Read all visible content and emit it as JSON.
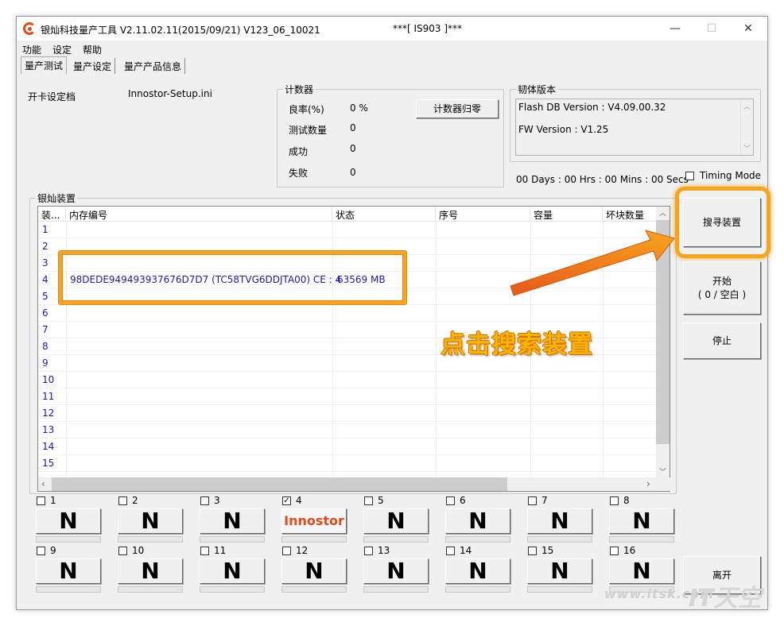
{
  "window": {
    "title": "银灿科技量产工具 V2.11.02.11(2015/09/21)    V123_06_10021",
    "title_center": "***[ IS903 ]***",
    "minimize": "—",
    "maximize": "☐",
    "close": "✕"
  },
  "menu": {
    "items": [
      "功能",
      "设定",
      "帮助"
    ]
  },
  "tabs": [
    "量产测试",
    "量产设定",
    "量产产品信息"
  ],
  "config": {
    "label": "开卡设定档",
    "value": "Innostor-Setup.ini"
  },
  "counter": {
    "legend": "计数器",
    "rows": [
      {
        "label": "良率(%)",
        "value": "0 %"
      },
      {
        "label": "测试数量",
        "value": "0"
      },
      {
        "label": "成功",
        "value": "0"
      },
      {
        "label": "失败",
        "value": "0"
      }
    ],
    "reset_button": "计数器归零"
  },
  "firmware": {
    "legend": "韧体版本",
    "flash_db": "Flash DB Version :  V4.09.00.32",
    "fw": "FW Version :   V1.25"
  },
  "timer": "00 Days : 00 Hrs : 00 Mins : 00 Secs",
  "timing_mode": "Timing Mode",
  "devices": {
    "legend": "银灿装置",
    "columns": [
      "装...",
      "内存编号",
      "状态",
      "序号",
      "容量",
      "坏块数量"
    ],
    "rows": [
      {
        "n": "1",
        "memory": "",
        "status": ""
      },
      {
        "n": "2",
        "memory": "",
        "status": ""
      },
      {
        "n": "3",
        "memory": "",
        "status": ""
      },
      {
        "n": "4",
        "memory": "98DEDE949493937676D7D7 (TC58TVG6DDJTA00) CE : 4",
        "status": "63569 MB"
      },
      {
        "n": "5",
        "memory": "",
        "status": ""
      },
      {
        "n": "6",
        "memory": "",
        "status": ""
      },
      {
        "n": "7",
        "memory": "",
        "status": ""
      },
      {
        "n": "8",
        "memory": "",
        "status": ""
      },
      {
        "n": "9",
        "memory": "",
        "status": ""
      },
      {
        "n": "10",
        "memory": "",
        "status": ""
      },
      {
        "n": "11",
        "memory": "",
        "status": ""
      },
      {
        "n": "12",
        "memory": "",
        "status": ""
      },
      {
        "n": "13",
        "memory": "",
        "status": ""
      },
      {
        "n": "14",
        "memory": "",
        "status": ""
      },
      {
        "n": "15",
        "memory": "",
        "status": ""
      }
    ]
  },
  "side_buttons": {
    "search": "搜寻装置",
    "start_line1": "开始",
    "start_line2": "( 0 / 空白 )",
    "stop": "停止",
    "exit": "离开"
  },
  "slots": [
    {
      "n": "1",
      "checked": false,
      "label": "N"
    },
    {
      "n": "2",
      "checked": false,
      "label": "N"
    },
    {
      "n": "3",
      "checked": false,
      "label": "N"
    },
    {
      "n": "4",
      "checked": true,
      "label": "Innostor"
    },
    {
      "n": "5",
      "checked": false,
      "label": "N"
    },
    {
      "n": "6",
      "checked": false,
      "label": "N"
    },
    {
      "n": "7",
      "checked": false,
      "label": "N"
    },
    {
      "n": "8",
      "checked": false,
      "label": "N"
    },
    {
      "n": "9",
      "checked": false,
      "label": "N"
    },
    {
      "n": "10",
      "checked": false,
      "label": "N"
    },
    {
      "n": "11",
      "checked": false,
      "label": "N"
    },
    {
      "n": "12",
      "checked": false,
      "label": "N"
    },
    {
      "n": "13",
      "checked": false,
      "label": "N"
    },
    {
      "n": "14",
      "checked": false,
      "label": "N"
    },
    {
      "n": "15",
      "checked": false,
      "label": "N"
    },
    {
      "n": "16",
      "checked": false,
      "label": "N"
    }
  ],
  "annotation": {
    "callout": "点击搜索装置"
  },
  "watermark": {
    "url": "www.itsk.com",
    "brand": "IT天空"
  },
  "colors": {
    "highlight": "#f7a41d",
    "brand": "#e64a19",
    "table_text": "#1b1bb5"
  }
}
